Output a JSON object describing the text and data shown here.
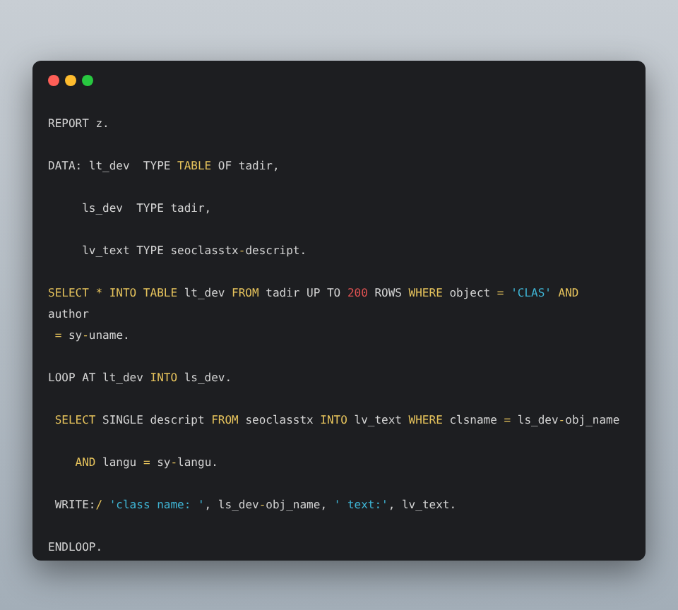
{
  "code_blocks": [
    {
      "lines": [
        {
          "tokens": [
            {
              "kind": "plain",
              "text": "REPORT z."
            }
          ]
        }
      ]
    },
    {
      "lines": [
        {
          "tokens": [
            {
              "kind": "plain",
              "text": "DATA: lt_dev  TYPE "
            },
            {
              "kind": "keyword",
              "text": "TABLE"
            },
            {
              "kind": "plain",
              "text": " OF tadir,"
            }
          ]
        }
      ]
    },
    {
      "lines": [
        {
          "tokens": [
            {
              "kind": "plain",
              "text": "     ls_dev  TYPE tadir,"
            }
          ]
        }
      ]
    },
    {
      "lines": [
        {
          "tokens": [
            {
              "kind": "plain",
              "text": "     lv_text TYPE seoclasstx"
            },
            {
              "kind": "keyword",
              "text": "-"
            },
            {
              "kind": "plain",
              "text": "descript."
            }
          ]
        }
      ]
    },
    {
      "lines": [
        {
          "tokens": [
            {
              "kind": "keyword",
              "text": "SELECT * INTO TABLE"
            },
            {
              "kind": "plain",
              "text": " lt_dev "
            },
            {
              "kind": "keyword",
              "text": "FROM"
            },
            {
              "kind": "plain",
              "text": " tadir UP TO "
            },
            {
              "kind": "number",
              "text": "200"
            },
            {
              "kind": "plain",
              "text": " ROWS "
            },
            {
              "kind": "keyword",
              "text": "WHERE"
            },
            {
              "kind": "plain",
              "text": " object "
            },
            {
              "kind": "keyword",
              "text": "= "
            },
            {
              "kind": "string",
              "text": "'CLAS'"
            },
            {
              "kind": "keyword",
              "text": " AND"
            }
          ]
        },
        {
          "tokens": [
            {
              "kind": "plain",
              "text": "author"
            }
          ]
        },
        {
          "tokens": [
            {
              "kind": "keyword",
              "text": " ="
            },
            {
              "kind": "plain",
              "text": " sy"
            },
            {
              "kind": "keyword",
              "text": "-"
            },
            {
              "kind": "plain",
              "text": "uname."
            }
          ]
        }
      ]
    },
    {
      "lines": [
        {
          "tokens": [
            {
              "kind": "plain",
              "text": "LOOP AT lt_dev "
            },
            {
              "kind": "keyword",
              "text": "INTO"
            },
            {
              "kind": "plain",
              "text": " ls_dev."
            }
          ]
        }
      ]
    },
    {
      "lines": [
        {
          "tokens": [
            {
              "kind": "keyword",
              "text": " SELECT"
            },
            {
              "kind": "plain",
              "text": " SINGLE descript "
            },
            {
              "kind": "keyword",
              "text": "FROM"
            },
            {
              "kind": "plain",
              "text": " seoclasstx "
            },
            {
              "kind": "keyword",
              "text": "INTO"
            },
            {
              "kind": "plain",
              "text": " lv_text "
            },
            {
              "kind": "keyword",
              "text": "WHERE"
            },
            {
              "kind": "plain",
              "text": " clsname "
            },
            {
              "kind": "keyword",
              "text": "="
            },
            {
              "kind": "plain",
              "text": " ls_dev"
            },
            {
              "kind": "keyword",
              "text": "-"
            },
            {
              "kind": "plain",
              "text": "obj_name"
            }
          ]
        }
      ]
    },
    {
      "lines": [
        {
          "tokens": [
            {
              "kind": "keyword",
              "text": "    AND"
            },
            {
              "kind": "plain",
              "text": " langu "
            },
            {
              "kind": "keyword",
              "text": "="
            },
            {
              "kind": "plain",
              "text": " sy"
            },
            {
              "kind": "keyword",
              "text": "-"
            },
            {
              "kind": "plain",
              "text": "langu."
            }
          ]
        }
      ]
    },
    {
      "lines": [
        {
          "tokens": [
            {
              "kind": "plain",
              "text": " WRITE:"
            },
            {
              "kind": "keyword",
              "text": "/ "
            },
            {
              "kind": "string",
              "text": "'class name: '"
            },
            {
              "kind": "plain",
              "text": ", ls_dev"
            },
            {
              "kind": "keyword",
              "text": "-"
            },
            {
              "kind": "plain",
              "text": "obj_name, "
            },
            {
              "kind": "string",
              "text": "' text:'"
            },
            {
              "kind": "plain",
              "text": ", lv_text."
            }
          ]
        }
      ]
    },
    {
      "lines": [
        {
          "tokens": [
            {
              "kind": "plain",
              "text": "ENDLOOP."
            }
          ]
        }
      ]
    }
  ]
}
